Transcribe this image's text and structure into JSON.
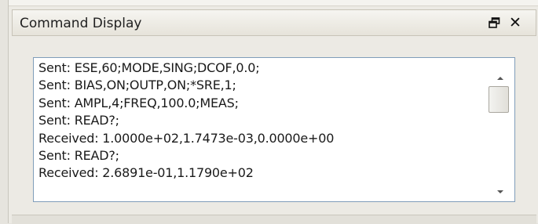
{
  "window": {
    "title": "Command Display",
    "restore_icon": "restore-window-icon",
    "close_label": "✕"
  },
  "log": {
    "lines": [
      "Sent: ESE,60;MODE,SING;DCOF,0.0;",
      "Sent: BIAS,ON;OUTP,ON;*SRE,1;",
      "Sent: AMPL,4;FREQ,100.0;MEAS;",
      "Sent: READ?;",
      "Received: 1.0000e+02,1.7473e-03,0.0000e+00",
      "Sent: READ?;",
      "Received: 2.6891e-01,1.1790e+02"
    ]
  },
  "scrollbar": {
    "up_icon": "scroll-up-arrow-icon",
    "down_icon": "scroll-down-arrow-icon"
  }
}
